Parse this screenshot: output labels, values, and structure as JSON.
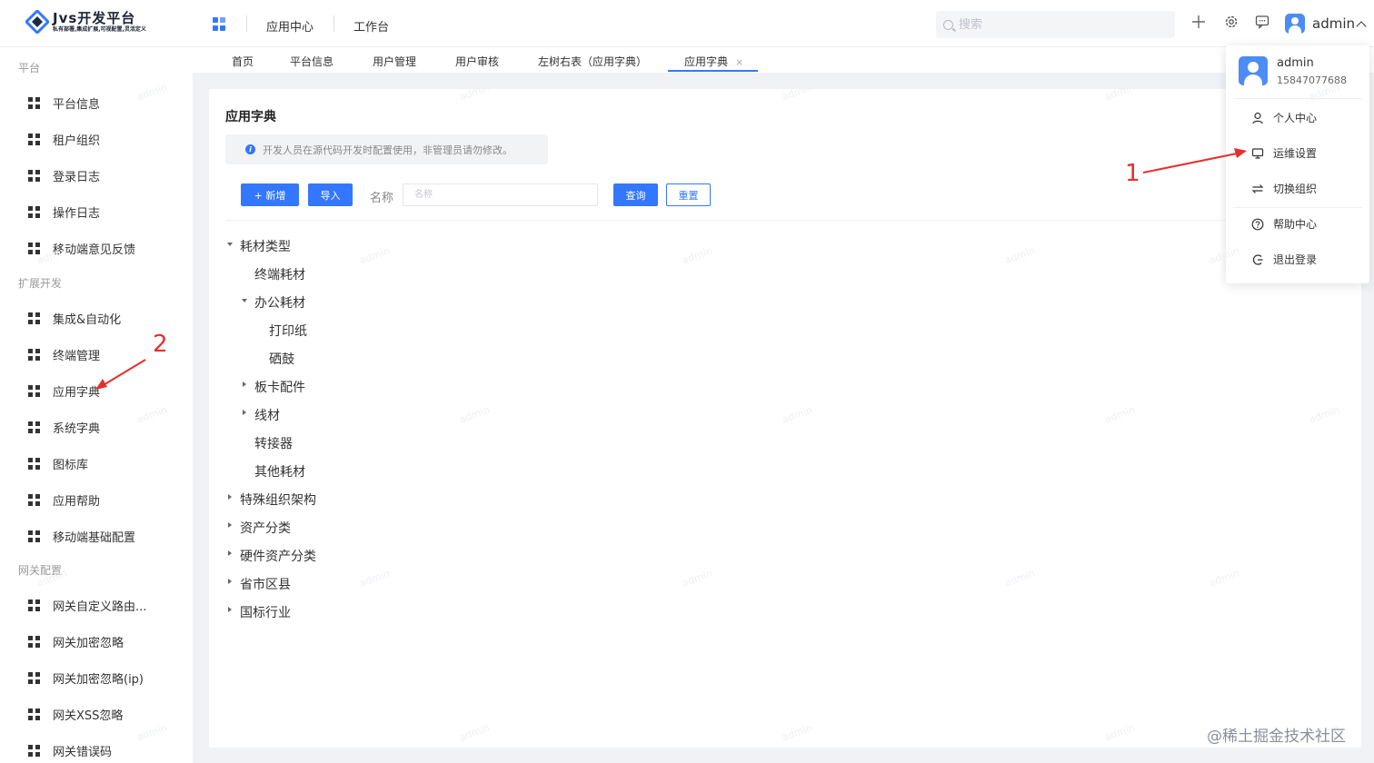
{
  "header": {
    "logo_title": "Jvs开发平台",
    "logo_subtitle": "私有部署,集成扩展,可视配置,灵活定义",
    "nav": [
      "应用中心",
      "工作台"
    ],
    "search_placeholder": "搜索",
    "user_name": "admin",
    "icons": [
      "plus-icon",
      "gear-icon",
      "message-icon"
    ]
  },
  "sidebar": {
    "groups": [
      {
        "label": "平台",
        "items": [
          "平台信息",
          "租户组织",
          "登录日志",
          "操作日志",
          "移动端意见反馈"
        ]
      },
      {
        "label": "扩展开发",
        "items": [
          "集成&自动化",
          "终端管理",
          "应用字典",
          "系统字典",
          "图标库",
          "应用帮助",
          "移动端基础配置"
        ]
      },
      {
        "label": "网关配置",
        "items": [
          "网关自定义路由...",
          "网关加密忽略",
          "网关加密忽略(ip)",
          "网关XSS忽略",
          "网关错误码"
        ]
      }
    ]
  },
  "tabs": [
    "首页",
    "平台信息",
    "用户管理",
    "用户审核",
    "左树右表（应用字典）",
    "应用字典"
  ],
  "tab_close": "×",
  "main": {
    "title": "应用字典",
    "notice": "开发人员在源代码开发时配置使用，非管理员请勿修改。",
    "buttons": {
      "add": "+ 新增",
      "import": "导入",
      "query": "查询",
      "reset": "重置"
    },
    "filter_label": "名称",
    "filter_placeholder": "名称"
  },
  "tree": [
    {
      "label": "耗材类型",
      "level": 0,
      "state": "expanded"
    },
    {
      "label": "终端耗材",
      "level": 1,
      "state": "leaf"
    },
    {
      "label": "办公耗材",
      "level": 1,
      "state": "expanded"
    },
    {
      "label": "打印纸",
      "level": 2,
      "state": "leaf"
    },
    {
      "label": "硒鼓",
      "level": 2,
      "state": "leaf"
    },
    {
      "label": "板卡配件",
      "level": 1,
      "state": "collapsed"
    },
    {
      "label": "线材",
      "level": 1,
      "state": "collapsed"
    },
    {
      "label": "转接器",
      "level": 1,
      "state": "leaf"
    },
    {
      "label": "其他耗材",
      "level": 1,
      "state": "leaf"
    },
    {
      "label": "特殊组织架构",
      "level": 0,
      "state": "collapsed"
    },
    {
      "label": "资产分类",
      "level": 0,
      "state": "collapsed"
    },
    {
      "label": "硬件资产分类",
      "level": 0,
      "state": "collapsed"
    },
    {
      "label": "省市区县",
      "level": 0,
      "state": "collapsed"
    },
    {
      "label": "国标行业",
      "level": 0,
      "state": "collapsed"
    }
  ],
  "dropdown": {
    "name": "admin",
    "phone": "15847077688",
    "items": [
      {
        "label": "个人中心",
        "icon": "user-icon"
      },
      {
        "label": "运维设置",
        "icon": "monitor-icon"
      },
      {
        "label": "切换组织",
        "icon": "swap-icon"
      },
      {
        "label": "帮助中心",
        "icon": "help-icon"
      },
      {
        "label": "退出登录",
        "icon": "logout-icon"
      }
    ]
  },
  "annotations": {
    "one": "1",
    "two": "2"
  },
  "watermark": "admin",
  "credit": "@稀土掘金技术社区",
  "colors": {
    "accent": "#3377ff",
    "annotation": "#e62e2e"
  }
}
